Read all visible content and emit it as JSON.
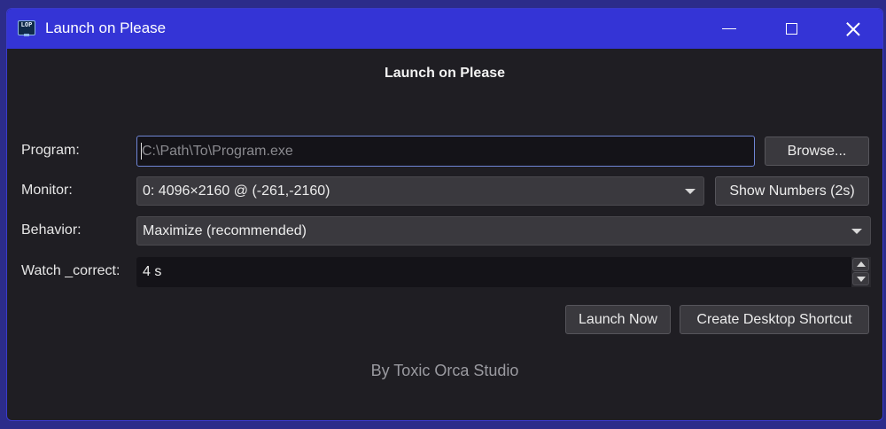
{
  "window": {
    "title": "Launch on Please",
    "icon_text": "LOP",
    "accent_color": "#3434d6"
  },
  "header": {
    "title": "Launch on Please"
  },
  "form": {
    "program": {
      "label": "Program:",
      "value": "",
      "placeholder": "C:\\Path\\To\\Program.exe",
      "browse_label": "Browse..."
    },
    "monitor": {
      "label": "Monitor:",
      "selected": "0: 4096×2160 @ (-261,-2160)",
      "show_numbers_label": "Show Numbers (2s)"
    },
    "behavior": {
      "label": "Behavior:",
      "selected": "Maximize (recommended)"
    },
    "watch": {
      "label": "Watch _correct:",
      "value": "4 s"
    }
  },
  "actions": {
    "launch_now_label": "Launch Now",
    "create_shortcut_label": "Create Desktop Shortcut"
  },
  "footer": {
    "text": "By Toxic Orca Studio"
  },
  "icons": {
    "minimize": "minimize-icon",
    "maximize": "maximize-icon",
    "close": "close-icon",
    "dropdown": "chevron-down-icon",
    "spin_up": "spin-up-icon",
    "spin_down": "spin-down-icon"
  }
}
